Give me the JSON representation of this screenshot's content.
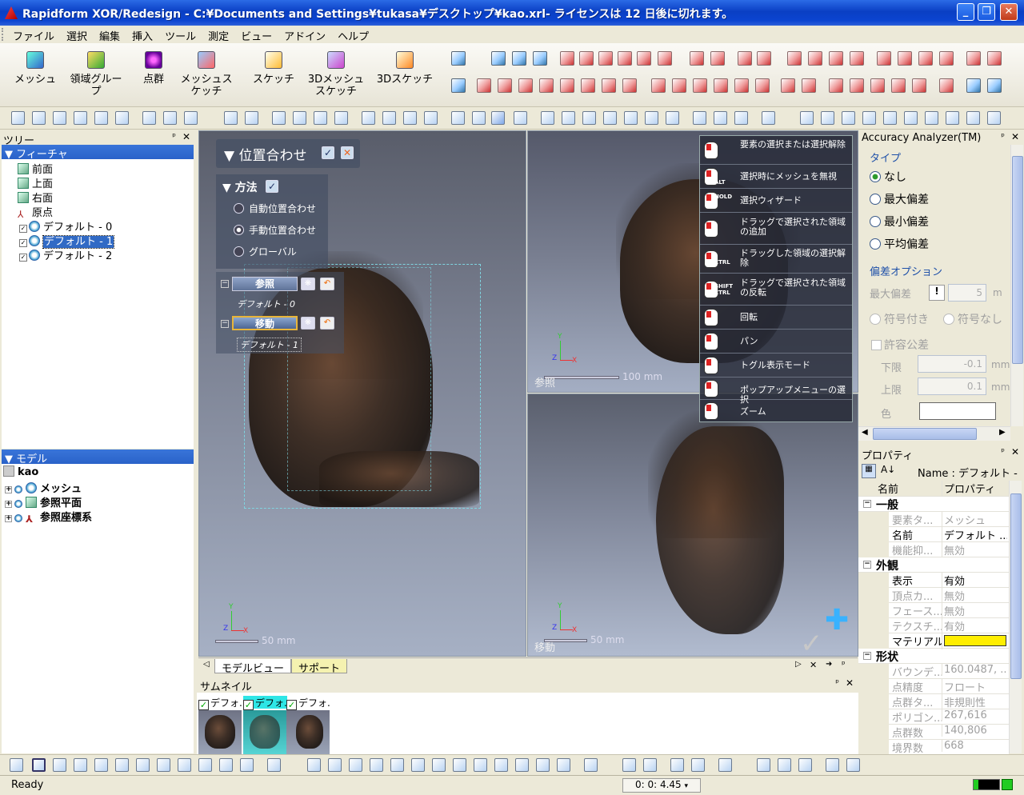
{
  "window": {
    "title": "Rapidform XOR/Redesign - C:¥Documents and Settings¥tukasa¥デスクトップ¥kao.xrl- ライセンスは 12 日後に切れます。",
    "min": "_",
    "max": "❐",
    "close": "✕"
  },
  "menu": [
    "ファイル",
    "選択",
    "編集",
    "挿入",
    "ツール",
    "測定",
    "ビュー",
    "アドイン",
    "ヘルプ"
  ],
  "ribbon": [
    {
      "label": "メッシュ"
    },
    {
      "label": "領域グループ"
    },
    {
      "label": "点群"
    },
    {
      "label": "メッシュスケッチ"
    },
    {
      "label": "スケッチ"
    },
    {
      "label": "3Dメッシュスケッチ"
    },
    {
      "label": "3Dスケッチ"
    }
  ],
  "tree_panel": {
    "title": "ツリー",
    "section": "フィーチャ",
    "items": [
      "前面",
      "上面",
      "右面",
      "原点",
      "デフォルト - 0",
      "デフォルト - 1",
      "デフォルト - 2"
    ]
  },
  "model_panel": {
    "section": "モデル",
    "root": "kao",
    "items": [
      "メッシュ",
      "参照平面",
      "参照座標系"
    ]
  },
  "align": {
    "title": "位置合わせ",
    "method": "方法",
    "options": [
      "自動位置合わせ",
      "手動位置合わせ",
      "グローバル"
    ],
    "ref_label": "参照",
    "ref_sub": "デフォルト - 0",
    "move_label": "移動",
    "move_sub": "デフォルト - 1"
  },
  "viewports": {
    "main_scale": "50 mm",
    "ref_scale": "100 mm",
    "ref_label": "参照",
    "move_scale": "50 mm",
    "move_label": "移動"
  },
  "axes": {
    "x": "X",
    "y": "Y",
    "z": "Z"
  },
  "popup_menu": [
    {
      "key": "",
      "text": "要素の選択または選択解除"
    },
    {
      "key": "ALT",
      "text": "選択時にメッシュを無視"
    },
    {
      "key": "HOLD",
      "text": "選択ウィザード"
    },
    {
      "key": "",
      "text": "ドラッグで選択された領域の追加"
    },
    {
      "key": "CTRL",
      "text": "ドラッグした領域の選択解除"
    },
    {
      "key": "SHIFT CTRL",
      "text": "ドラッグで選択された領域の反転"
    },
    {
      "key": "",
      "text": "回転"
    },
    {
      "key": "",
      "text": "パン"
    },
    {
      "key": "",
      "text": "トグル表示モード"
    },
    {
      "key": "",
      "text": "ポップアップメニューの選択"
    },
    {
      "key": "",
      "text": "ズーム"
    }
  ],
  "view_tabs": [
    "モデルビュー",
    "サポート"
  ],
  "thumbnails": {
    "title": "サムネイル",
    "items": [
      "デフォ.",
      "デフォ.",
      "デフォ."
    ]
  },
  "accuracy": {
    "title": "Accuracy Analyzer(TM)",
    "type_group": "タイプ",
    "types": [
      "なし",
      "最大偏差",
      "最小偏差",
      "平均偏差"
    ],
    "dev_group": "偏差オプション",
    "max_dev": "最大偏差",
    "max_dev_value": "5",
    "unit": "m",
    "signed": "符号付き",
    "unsigned": "符号なし",
    "tolerance": "許容公差",
    "lower": "下限",
    "lower_value": "-0.1",
    "upper": "上限",
    "upper_value": "0.1",
    "mm": "mm",
    "color": "色"
  },
  "properties": {
    "title": "プロパティ",
    "name_label": "Name : デフォルト -",
    "col_name": "名前",
    "col_prop": "プロパティ",
    "rows": [
      {
        "cat": "一般"
      },
      {
        "n": "要素タ...",
        "v": "メッシュ",
        "grey": true
      },
      {
        "n": "名前",
        "v": "デフォルト ...",
        "grey": false
      },
      {
        "n": "機能抑...",
        "v": "無効",
        "grey": true
      },
      {
        "cat": "外観"
      },
      {
        "n": "表示",
        "v": "有効",
        "grey": false
      },
      {
        "n": "頂点カ...",
        "v": "無効",
        "grey": true
      },
      {
        "n": "フェース...",
        "v": "無効",
        "grey": true
      },
      {
        "n": "テクスチ...",
        "v": "有効",
        "grey": true
      },
      {
        "n": "マテリアル",
        "v": "",
        "grey": false,
        "color": "#ffee00"
      },
      {
        "cat": "形状"
      },
      {
        "n": "バウンデ...",
        "v": "160.0487, ...",
        "grey": true
      },
      {
        "n": "点精度",
        "v": "フロート",
        "grey": true
      },
      {
        "n": "点群タ...",
        "v": "非規則性",
        "grey": true
      },
      {
        "n": "ポリゴン...",
        "v": "267,616",
        "grey": true
      },
      {
        "n": "点群数",
        "v": "140,806",
        "grey": true
      },
      {
        "n": "境界数",
        "v": "668",
        "grey": true
      }
    ]
  },
  "status": {
    "text": "Ready",
    "time": "0: 0: 4.45"
  },
  "colors": {
    "titlebar": "#0a3fc4",
    "selection": "#316ac5",
    "material": "#ffee00",
    "popup_icon": "#d22222"
  }
}
